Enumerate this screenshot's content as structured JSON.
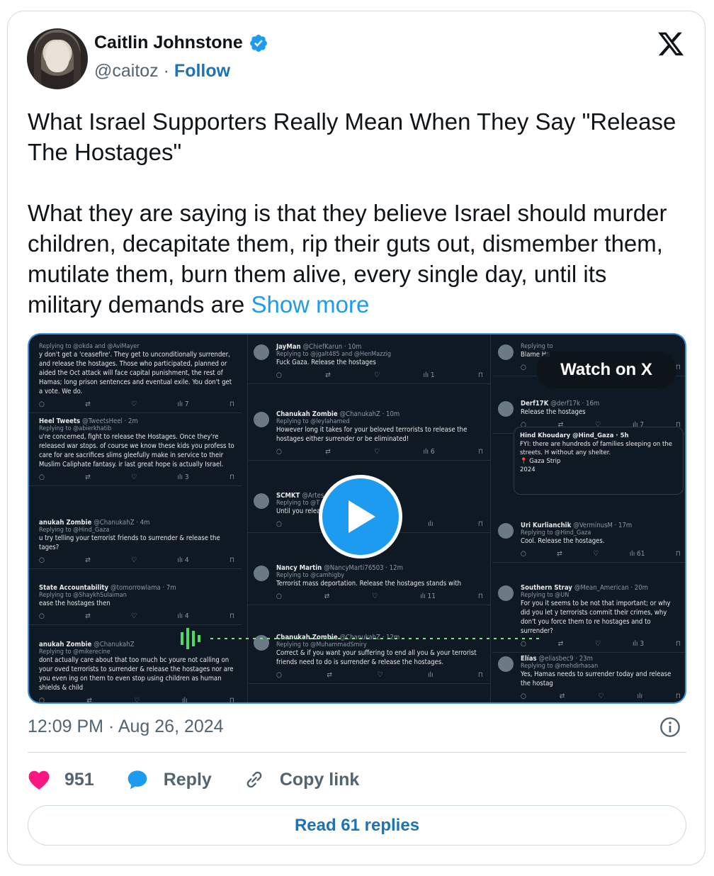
{
  "author": {
    "name": "Caitlin Johnstone",
    "handle": "@caitoz",
    "separator": "·",
    "follow_label": "Follow"
  },
  "tweet": {
    "paragraph1": "What Israel Supporters Really Mean When They Say \"Release The Hostages\"",
    "paragraph2": "What they are saying is that they believe Israel should murder children, decapitate them, rip their guts out, dismember them, mutilate them, burn them alive, every single day, until its military demands are ",
    "show_more": "Show more"
  },
  "media": {
    "watch_label": "Watch on X",
    "tweets": [
      {
        "col": "c1",
        "head": "",
        "handle": "",
        "reply": "Replying to @okda and @AviMayer",
        "body": "y don't get a 'ceasefire'. They get to unconditionally surrender, and release the hostages. Those who participated, planned or aided the Oct attack will face capital punishment, the rest of Hamas; long prison sentences and eventual exile. You don't get a vote. We do.",
        "stats": "7"
      },
      {
        "col": "c1",
        "head": "Heel Tweets",
        "handle": "@TweetsHeel · 2m",
        "reply": "Replying to @abierkhatib",
        "body": "u're concerned, fight to release the Hostages. Once they're released war stops. of course we know these kids you profess to care for are sacrifices slims gleefully make in service to their Muslim Caliphate fantasy. ir last great hope is actually Israel.",
        "stats": "3"
      },
      {
        "col": "c1",
        "head": "anukah Zombie",
        "handle": "@ChanukahZ · 4m",
        "reply": "Replying to @Hind_Gaza",
        "body": "u try telling your terrorist friends to surrender & release the tages?",
        "stats": "4"
      },
      {
        "col": "c1",
        "head": "State Accountability",
        "handle": "@tomorrowlama · 7m",
        "reply": "Replying to @ShaykhSulaiman",
        "body": "ease the hostages then",
        "stats": "4"
      },
      {
        "col": "c1",
        "head": "anukah Zombie",
        "handle": "@ChanukahZ",
        "reply": "Replying to @mikerecine",
        "body": "dont actually care about that too much bc youre not calling on your oved terrorists to surrender & release the hostages nor are you even ing on them to even stop using children as human shields & child",
        "stats": ""
      },
      {
        "col": "c2",
        "head": "JayMan",
        "handle": "@ChiefKarun · 10m",
        "reply": "Replying to @jgalt485 and @HenMazzig",
        "body": "Fuck Gaza. Release the hostages",
        "stats": "1"
      },
      {
        "col": "c2",
        "head": "Chanukah Zombie",
        "handle": "@ChanukahZ · 10m",
        "reply": "Replying to @leylahamed",
        "body": "However long it takes for your beloved terrorists to release the hostages either surrender or be eliminated!",
        "stats": "6"
      },
      {
        "col": "c2",
        "head": "SCMKT",
        "handle": "@Artes",
        "reply": "Replying to @T",
        "body": "Until you relea",
        "stats": ""
      },
      {
        "col": "c2",
        "head": "Nancy Martin",
        "handle": "@NancyMarti76503 · 12m",
        "reply": "Replying to @camhigby",
        "body": "Terrorist mass deportation. Release the hostages stands with",
        "stats": "11"
      },
      {
        "col": "c2",
        "head": "Chanukah Zombie",
        "handle": "@ChanukahZ · 12m",
        "reply": "Replying to @MuhammadSmiry",
        "body": "Correct & if you want your suffering to end all you & your terrorist friends need to do is surrender & release the hostages.",
        "stats": ""
      },
      {
        "col": "c3",
        "head": "",
        "handle": "",
        "reply": "Replying to",
        "body": "Blame Ha",
        "stats": ""
      },
      {
        "col": "c3",
        "head": "Derf17K",
        "handle": "@derf17k · 16m",
        "reply": "",
        "body": "Release the hostages",
        "stats": "7"
      },
      {
        "col": "c3",
        "head": "Uri Kurlianchik",
        "handle": "@VerminusM · 17m",
        "reply": "Replying to @Hind_Gaza",
        "body": "Cool. Release the hostages.",
        "stats": "61"
      },
      {
        "col": "c3",
        "head": "Southern Stray",
        "handle": "@Mean_American · 20m",
        "reply": "Replying to @UN",
        "body": "For you it seems to be not that important; or why did you let y terrorists commit their crimes, why don't you force them to re hostages and to surrender?",
        "stats": "3"
      },
      {
        "col": "c3",
        "head": "Elías",
        "handle": "@eliasbec9 · 23m",
        "reply": "Replying to @mehdirhasan",
        "body": "Yes, Hamas needs to surrender today and release the hostag",
        "stats": ""
      }
    ],
    "quoted": {
      "head": "Hind Khoudary",
      "handle": "@Hind_Gaza · 5h",
      "body": "FYI: there are hundreds of families sleeping on the streets. H without any shelter.",
      "place": "Gaza Strip",
      "year": "2024"
    }
  },
  "meta": {
    "timestamp": "12:09 PM · Aug 26, 2024"
  },
  "actions": {
    "likes": "951",
    "reply_label": "Reply",
    "copy_label": "Copy link",
    "read_replies": "Read 61 replies"
  },
  "colors": {
    "accent": "#1d9bf0",
    "link": "#1d72b8",
    "heart": "#f91880",
    "muted": "#536471"
  }
}
